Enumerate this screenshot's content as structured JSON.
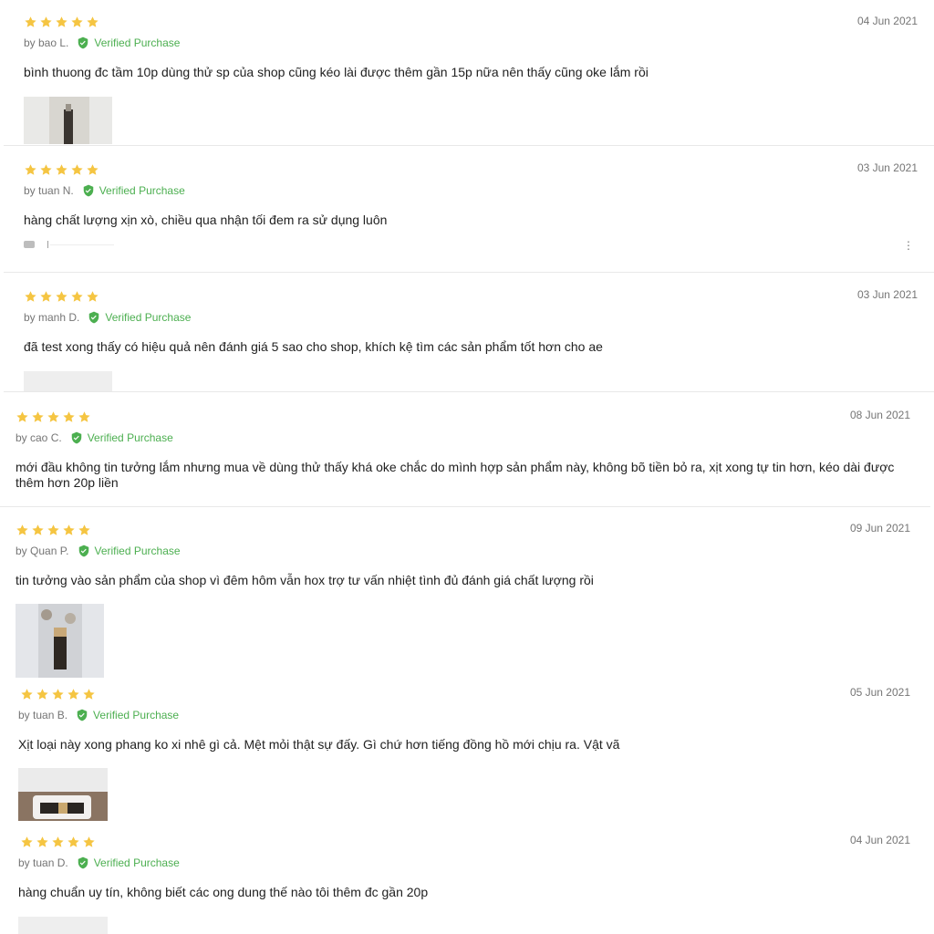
{
  "colors": {
    "star": "#f5c542",
    "verified": "#4caf50",
    "meta": "#757575",
    "text": "#212121",
    "divider": "#e8e8e8"
  },
  "verified_label": "Verified Purchase",
  "reviews": [
    {
      "rating": 5,
      "author": "by bao L.",
      "date": "04 Jun 2021",
      "text": "bình thuong đc tầm 10p dùng thử sp của shop cũng kéo lài được thêm gần 15p nữa nên thấy cũng oke lắm rồi",
      "has_image": true
    },
    {
      "rating": 5,
      "author": "by tuan N.",
      "date": "03 Jun 2021",
      "text": "hàng chất lượng xịn xò, chiều qua nhận tối đem ra sử dụng luôn",
      "has_image": false,
      "has_like": true,
      "more_icon": "⋮"
    },
    {
      "rating": 5,
      "author": "by manh D.",
      "date": "03 Jun 2021",
      "text": "đã test xong thấy có hiệu quả nên đánh giá 5 sao cho shop, khích kệ tìm các sản phẩm tốt hơn cho ae",
      "has_image": true
    },
    {
      "rating": 5,
      "author": "by cao C.",
      "date": "08 Jun 2021",
      "text": "mới đầu không tin tưởng lắm nhưng mua về dùng thử thấy khá oke chắc do mình hợp sản phẩm này, không bõ tiền bỏ ra, xịt xong tự tin hơn, kéo dài được thêm hơn 20p liền",
      "has_image": false
    },
    {
      "rating": 5,
      "author": "by Quan P.",
      "date": "09 Jun 2021",
      "text": "tin tưởng vào sản phẩm của shop vì đêm hôm vẫn hox trợ tư vấn nhiệt tình đủ đánh giá chất lượng rồi",
      "has_image": true
    },
    {
      "rating": 5,
      "author": "by tuan B.",
      "date": "05 Jun 2021",
      "text": "Xịt loại này xong phang ko xi nhê gì cả. Mệt mỏi thật sự đấy. Gì chứ hơn tiếng đồng hồ mới chịu ra. Vật vã",
      "has_image": true
    },
    {
      "rating": 5,
      "author": "by tuan D.",
      "date": "04 Jun 2021",
      "text": "hàng chuẩn uy tín, không biết các ong dung thế nào tôi thêm đc gần 20p",
      "has_image": true
    }
  ]
}
